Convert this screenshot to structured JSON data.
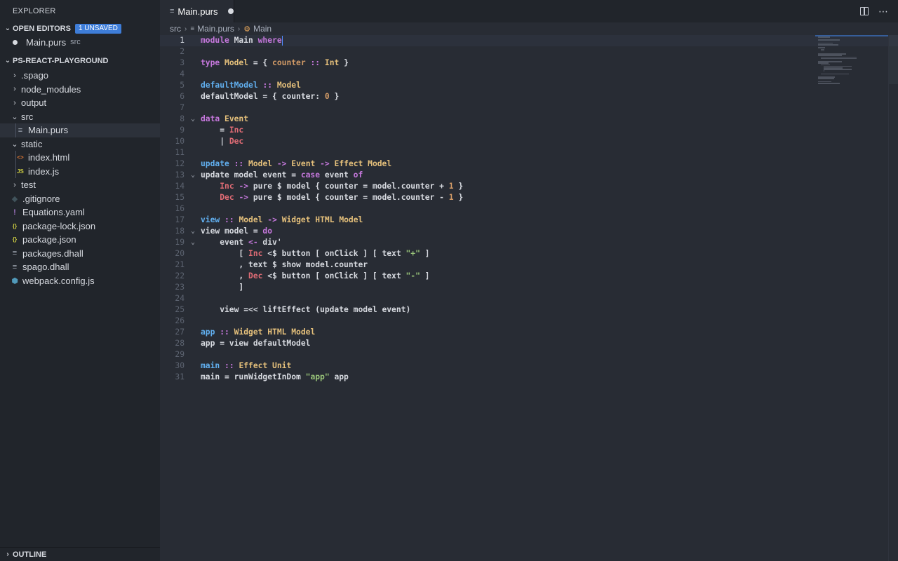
{
  "sidebar": {
    "title": "EXPLORER",
    "open_editors": {
      "label": "OPEN EDITORS",
      "badge": "1 UNSAVED",
      "items": [
        {
          "name": "Main.purs",
          "description": "src"
        }
      ]
    },
    "project": {
      "label": "PS-REACT-PLAYGROUND",
      "items": [
        {
          "label": ".spago",
          "kind": "folder",
          "expanded": false
        },
        {
          "label": "node_modules",
          "kind": "folder",
          "expanded": false
        },
        {
          "label": "output",
          "kind": "folder",
          "expanded": false
        },
        {
          "label": "src",
          "kind": "folder",
          "expanded": true
        },
        {
          "label": "Main.purs",
          "kind": "file",
          "icon": "lines-icon"
        },
        {
          "label": "static",
          "kind": "folder",
          "expanded": true
        },
        {
          "label": "index.html",
          "kind": "file",
          "icon": "html-icon"
        },
        {
          "label": "index.js",
          "kind": "file",
          "icon": "js-icon"
        },
        {
          "label": "test",
          "kind": "folder",
          "expanded": false
        },
        {
          "label": ".gitignore",
          "kind": "file",
          "icon": "git-icon"
        },
        {
          "label": "Equations.yaml",
          "kind": "file",
          "icon": "yaml-icon"
        },
        {
          "label": "package-lock.json",
          "kind": "file",
          "icon": "json-icon"
        },
        {
          "label": "package.json",
          "kind": "file",
          "icon": "json-icon"
        },
        {
          "label": "packages.dhall",
          "kind": "file",
          "icon": "lines-icon"
        },
        {
          "label": "spago.dhall",
          "kind": "file",
          "icon": "lines-icon"
        },
        {
          "label": "webpack.config.js",
          "kind": "file",
          "icon": "webpack-icon"
        }
      ]
    },
    "outline_label": "OUTLINE"
  },
  "tab": {
    "label": "Main.purs",
    "unsaved": true
  },
  "breadcrumb": [
    "src",
    "Main.purs",
    "Main"
  ],
  "editor": {
    "current_line": 1,
    "lines": [
      [
        [
          "k",
          "module "
        ],
        [
          "p",
          "Main "
        ],
        [
          "k",
          "where"
        ]
      ],
      [],
      [
        [
          "k",
          "type "
        ],
        [
          "t",
          "Model"
        ],
        [
          "p",
          " = { "
        ],
        [
          "n",
          "counter"
        ],
        [
          "p",
          " "
        ],
        [
          "o",
          "::"
        ],
        [
          "p",
          " "
        ],
        [
          "t",
          "Int"
        ],
        [
          "p",
          " }"
        ]
      ],
      [],
      [
        [
          "f",
          "defaultModel"
        ],
        [
          "p",
          " "
        ],
        [
          "o",
          "::"
        ],
        [
          "p",
          " "
        ],
        [
          "t",
          "Model"
        ]
      ],
      [
        [
          "p",
          "defaultModel = { counter: "
        ],
        [
          "n",
          "0"
        ],
        [
          "p",
          " }"
        ]
      ],
      [],
      [
        [
          "k",
          "data "
        ],
        [
          "t",
          "Event"
        ]
      ],
      [
        [
          "p",
          "    = "
        ],
        [
          "c",
          "Inc"
        ]
      ],
      [
        [
          "p",
          "    | "
        ],
        [
          "c",
          "Dec"
        ]
      ],
      [],
      [
        [
          "f",
          "update"
        ],
        [
          "p",
          " "
        ],
        [
          "o",
          "::"
        ],
        [
          "p",
          " "
        ],
        [
          "t",
          "Model"
        ],
        [
          "p",
          " "
        ],
        [
          "o",
          "->"
        ],
        [
          "p",
          " "
        ],
        [
          "t",
          "Event"
        ],
        [
          "p",
          " "
        ],
        [
          "o",
          "->"
        ],
        [
          "p",
          " "
        ],
        [
          "t",
          "Effect Model"
        ]
      ],
      [
        [
          "p",
          "update model event = "
        ],
        [
          "k",
          "case"
        ],
        [
          "p",
          " event "
        ],
        [
          "k",
          "of"
        ]
      ],
      [
        [
          "p",
          "    "
        ],
        [
          "c",
          "Inc"
        ],
        [
          "p",
          " "
        ],
        [
          "o",
          "->"
        ],
        [
          "p",
          " pure $ model { counter = model.counter + "
        ],
        [
          "n",
          "1"
        ],
        [
          "p",
          " }"
        ]
      ],
      [
        [
          "p",
          "    "
        ],
        [
          "c",
          "Dec"
        ],
        [
          "p",
          " "
        ],
        [
          "o",
          "->"
        ],
        [
          "p",
          " pure $ model { counter = model.counter - "
        ],
        [
          "n",
          "1"
        ],
        [
          "p",
          " }"
        ]
      ],
      [],
      [
        [
          "f",
          "view"
        ],
        [
          "p",
          " "
        ],
        [
          "o",
          "::"
        ],
        [
          "p",
          " "
        ],
        [
          "t",
          "Model"
        ],
        [
          "p",
          " "
        ],
        [
          "o",
          "->"
        ],
        [
          "p",
          " "
        ],
        [
          "t",
          "Widget HTML Model"
        ]
      ],
      [
        [
          "p",
          "view model = "
        ],
        [
          "k",
          "do"
        ]
      ],
      [
        [
          "p",
          "    event "
        ],
        [
          "o",
          "<-"
        ],
        [
          "p",
          " div'"
        ]
      ],
      [
        [
          "p",
          "        [ "
        ],
        [
          "c",
          "Inc"
        ],
        [
          "p",
          " <$ button [ onClick ] [ text "
        ],
        [
          "s",
          "\"+\""
        ],
        [
          "p",
          " ]"
        ]
      ],
      [
        [
          "p",
          "        , text $ show model.counter"
        ]
      ],
      [
        [
          "p",
          "        , "
        ],
        [
          "c",
          "Dec"
        ],
        [
          "p",
          " <$ button [ onClick ] [ text "
        ],
        [
          "s",
          "\"-\""
        ],
        [
          "p",
          " ]"
        ]
      ],
      [
        [
          "p",
          "        ]"
        ]
      ],
      [],
      [
        [
          "p",
          "    view =<< liftEffect (update model event)"
        ]
      ],
      [],
      [
        [
          "f",
          "app"
        ],
        [
          "p",
          " "
        ],
        [
          "o",
          "::"
        ],
        [
          "p",
          " "
        ],
        [
          "t",
          "Widget HTML Model"
        ]
      ],
      [
        [
          "p",
          "app = view defaultModel"
        ]
      ],
      [],
      [
        [
          "f",
          "main"
        ],
        [
          "p",
          " "
        ],
        [
          "o",
          "::"
        ],
        [
          "p",
          " "
        ],
        [
          "t",
          "Effect Unit"
        ]
      ],
      [
        [
          "p",
          "main = runWidgetInDom "
        ],
        [
          "s",
          "\"app\""
        ],
        [
          "p",
          " app"
        ]
      ]
    ],
    "folds": [
      8,
      13,
      18,
      19
    ]
  }
}
